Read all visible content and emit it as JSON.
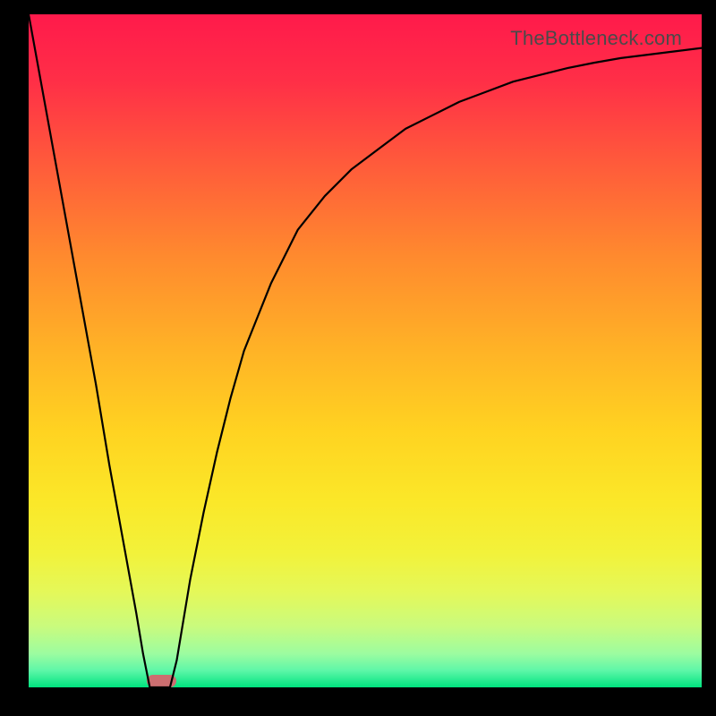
{
  "watermark": "TheBottleneck.com",
  "chart_data": {
    "type": "line",
    "title": "",
    "xlabel": "",
    "ylabel": "",
    "xlim": [
      0,
      100
    ],
    "ylim": [
      0,
      100
    ],
    "x": [
      0,
      2,
      4,
      6,
      8,
      10,
      12,
      14,
      16,
      17,
      18,
      19,
      20,
      21,
      22,
      23,
      24,
      26,
      28,
      30,
      32,
      34,
      36,
      38,
      40,
      44,
      48,
      52,
      56,
      60,
      64,
      68,
      72,
      76,
      80,
      84,
      88,
      92,
      96,
      100
    ],
    "values": [
      100,
      89,
      78,
      67,
      56,
      45,
      33,
      22,
      11,
      5,
      0,
      0,
      0,
      0,
      4,
      10,
      16,
      26,
      35,
      43,
      50,
      55,
      60,
      64,
      68,
      73,
      77,
      80,
      83,
      85,
      87,
      88.5,
      90,
      91,
      92,
      92.8,
      93.5,
      94,
      94.5,
      95
    ],
    "marker": {
      "x_start": 17.5,
      "x_end": 22,
      "y": 0
    },
    "gradient_stops": [
      {
        "pos": 0.0,
        "color": "#ff1a4b"
      },
      {
        "pos": 0.1,
        "color": "#ff2f47"
      },
      {
        "pos": 0.22,
        "color": "#ff5a3b"
      },
      {
        "pos": 0.36,
        "color": "#ff8a2e"
      },
      {
        "pos": 0.5,
        "color": "#ffb326"
      },
      {
        "pos": 0.62,
        "color": "#ffd321"
      },
      {
        "pos": 0.72,
        "color": "#fbe728"
      },
      {
        "pos": 0.8,
        "color": "#f2f23a"
      },
      {
        "pos": 0.86,
        "color": "#e4f85a"
      },
      {
        "pos": 0.91,
        "color": "#c9fb7e"
      },
      {
        "pos": 0.95,
        "color": "#9cfca0"
      },
      {
        "pos": 0.975,
        "color": "#5ef7a8"
      },
      {
        "pos": 1.0,
        "color": "#00e37f"
      }
    ]
  }
}
